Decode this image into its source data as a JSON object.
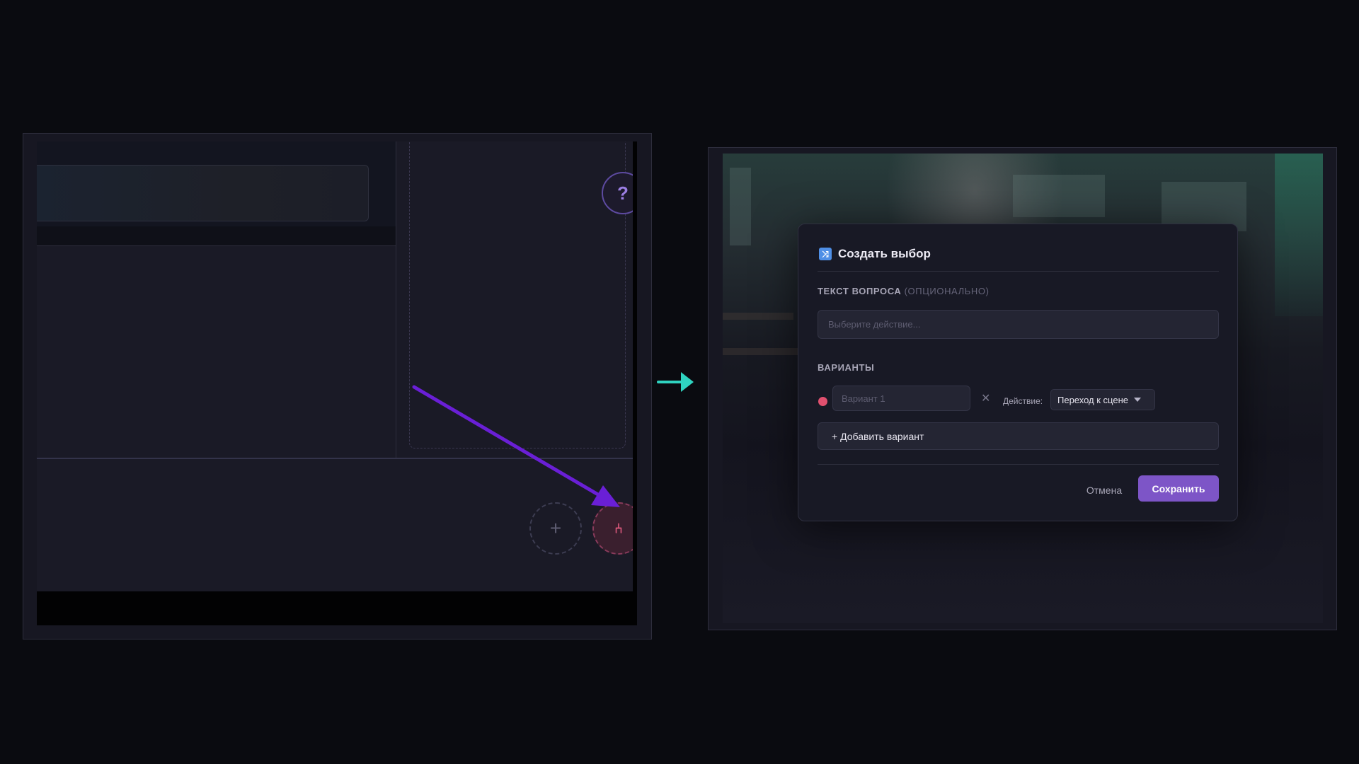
{
  "left_panel": {
    "help_button_label": "?",
    "add_button_label": "+",
    "choice_button_label": "⑃"
  },
  "modal": {
    "title": "Создать выбор",
    "title_icon": "shuffle-icon",
    "question_label": "ТЕКСТ ВОПРОСА",
    "question_label_optional": "(ОПЦИОНАЛЬНО)",
    "question_placeholder": "Выберите действие...",
    "options_label": "ВАРИАНТЫ",
    "options": [
      {
        "placeholder": "Вариант 1",
        "color": "#e0506f",
        "remove_label": "✕",
        "action_label": "Действие:",
        "action_value": "Переход к сцене"
      }
    ],
    "add_option_label": "+ Добавить вариант",
    "cancel_label": "Отмена",
    "save_label": "Сохранить"
  },
  "colors": {
    "accent": "#7d55c7",
    "arrow_purple": "#6a1fd6",
    "arrow_teal": "#2fd3c0",
    "option_dot": "#e0506f"
  }
}
